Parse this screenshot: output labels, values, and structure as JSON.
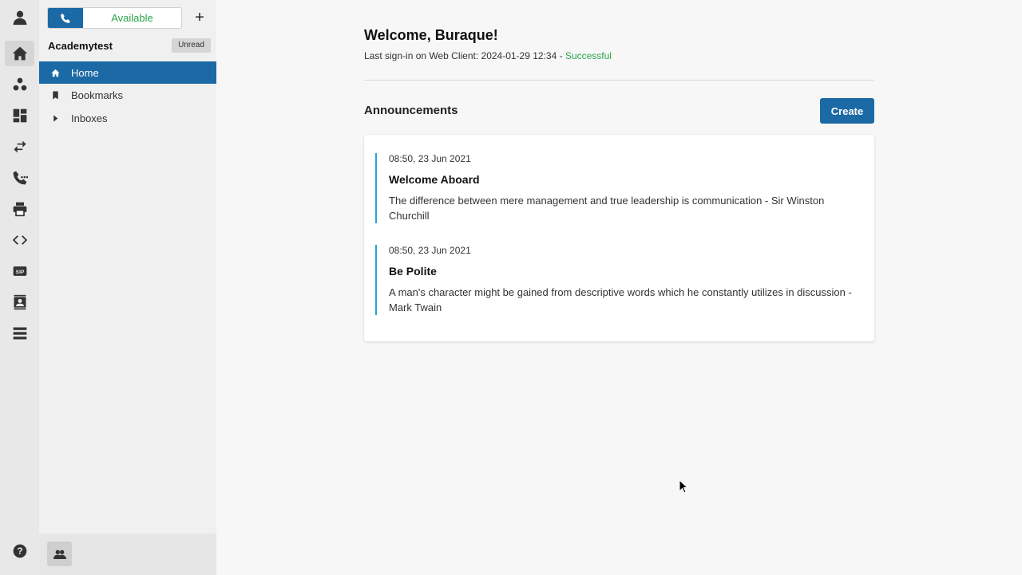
{
  "rail": {
    "icons": [
      "user-icon",
      "home-icon",
      "contacts-icon",
      "dashboard-icon",
      "transfer-icon",
      "call-log-icon",
      "printer-icon",
      "code-icon",
      "sip-icon",
      "address-book-icon",
      "list-icon",
      "help-icon"
    ]
  },
  "presence": {
    "status": "Available",
    "status_color": "#2aa54a",
    "accent": "#1b6aa5"
  },
  "sidebar": {
    "org_name": "Academytest",
    "unread_label": "Unread",
    "items": [
      {
        "label": "Home",
        "icon": "home-icon",
        "active": true
      },
      {
        "label": "Bookmarks",
        "icon": "bookmark-icon",
        "active": false
      },
      {
        "label": "Inboxes",
        "icon": "chevron-right-icon",
        "active": false
      }
    ]
  },
  "main": {
    "welcome": "Welcome, Buraque!",
    "signin_prefix": "Last sign-in on Web Client: 2024-01-29 12:34 - ",
    "signin_status": "Successful",
    "announcements_title": "Announcements",
    "create_label": "Create",
    "announcements": [
      {
        "date": "08:50, 23 Jun 2021",
        "title": "Welcome Aboard",
        "body": "The difference between mere management and true leadership is communication - Sir Winston Churchill"
      },
      {
        "date": "08:50, 23 Jun 2021",
        "title": "Be Polite",
        "body": "A man's character might be gained from descriptive words which he constantly utilizes in discussion - Mark Twain"
      }
    ]
  }
}
